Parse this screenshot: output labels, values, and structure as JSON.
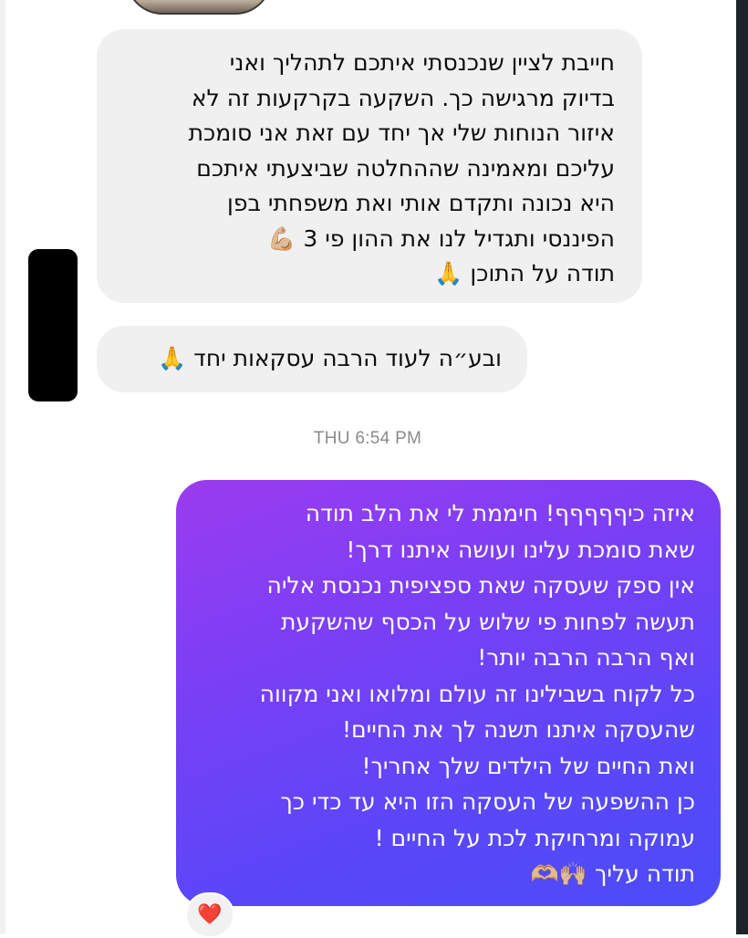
{
  "conversation": {
    "incoming": [
      {
        "lines": [
          "חייבת לציין שנכנסתי איתכם לתהליך ואני",
          "בדיוק מרגישה כך. השקעה בקרקעות זה לא",
          "איזור הנוחות שלי אך יחד עם זאת אני סומכת",
          "עליכם ומאמינה שההחלטה שביצעתי איתכם",
          "היא נכונה ותקדם אותי ואת משפחתי בפן",
          "הפיננסי ותגדיל לנו את ההון פי 3 💪🏼",
          "תודה על התוכן 🙏"
        ]
      },
      {
        "lines": [
          "ובע״ה לעוד הרבה עסקאות יחד 🙏"
        ]
      }
    ],
    "timestamp": "THU 6:54 PM",
    "outgoing": {
      "lines": [
        "איזה כיףףףףף! חיממת לי את הלב תודה",
        "שאת סומכת עלינו ועושה איתנו דרך!",
        "אין ספק שעסקה שאת ספציפית נכנסת אליה",
        "תעשה לפחות פי שלוש על הכסף שהשקעת",
        "ואף הרבה הרבה יותר!",
        "כל לקוח בשבילינו זה עולם ומלואו ואני מקווה",
        "שהעסקה איתנו תשנה לך את החיים!",
        "ואת החיים של הילדים שלך אחריך!",
        "כן ההשפעה של העסקה הזו היא עד כדי כך",
        "עמוקה ומרחיקת לכת על החיים !",
        "תודה עליך 🙌🏼🫶🏼"
      ],
      "reaction": "❤️"
    }
  },
  "colors": {
    "incoming_bubble": "#f0f0f0",
    "outgoing_gradient_start": "#9b3cf0",
    "outgoing_gradient_end": "#4c4cf8",
    "timestamp_text": "#8b8b8b",
    "reaction": "#e8202e"
  },
  "icons": {
    "avatar": "avatar-photo",
    "redaction": "black-redaction-block",
    "reaction": "red-heart-icon"
  }
}
